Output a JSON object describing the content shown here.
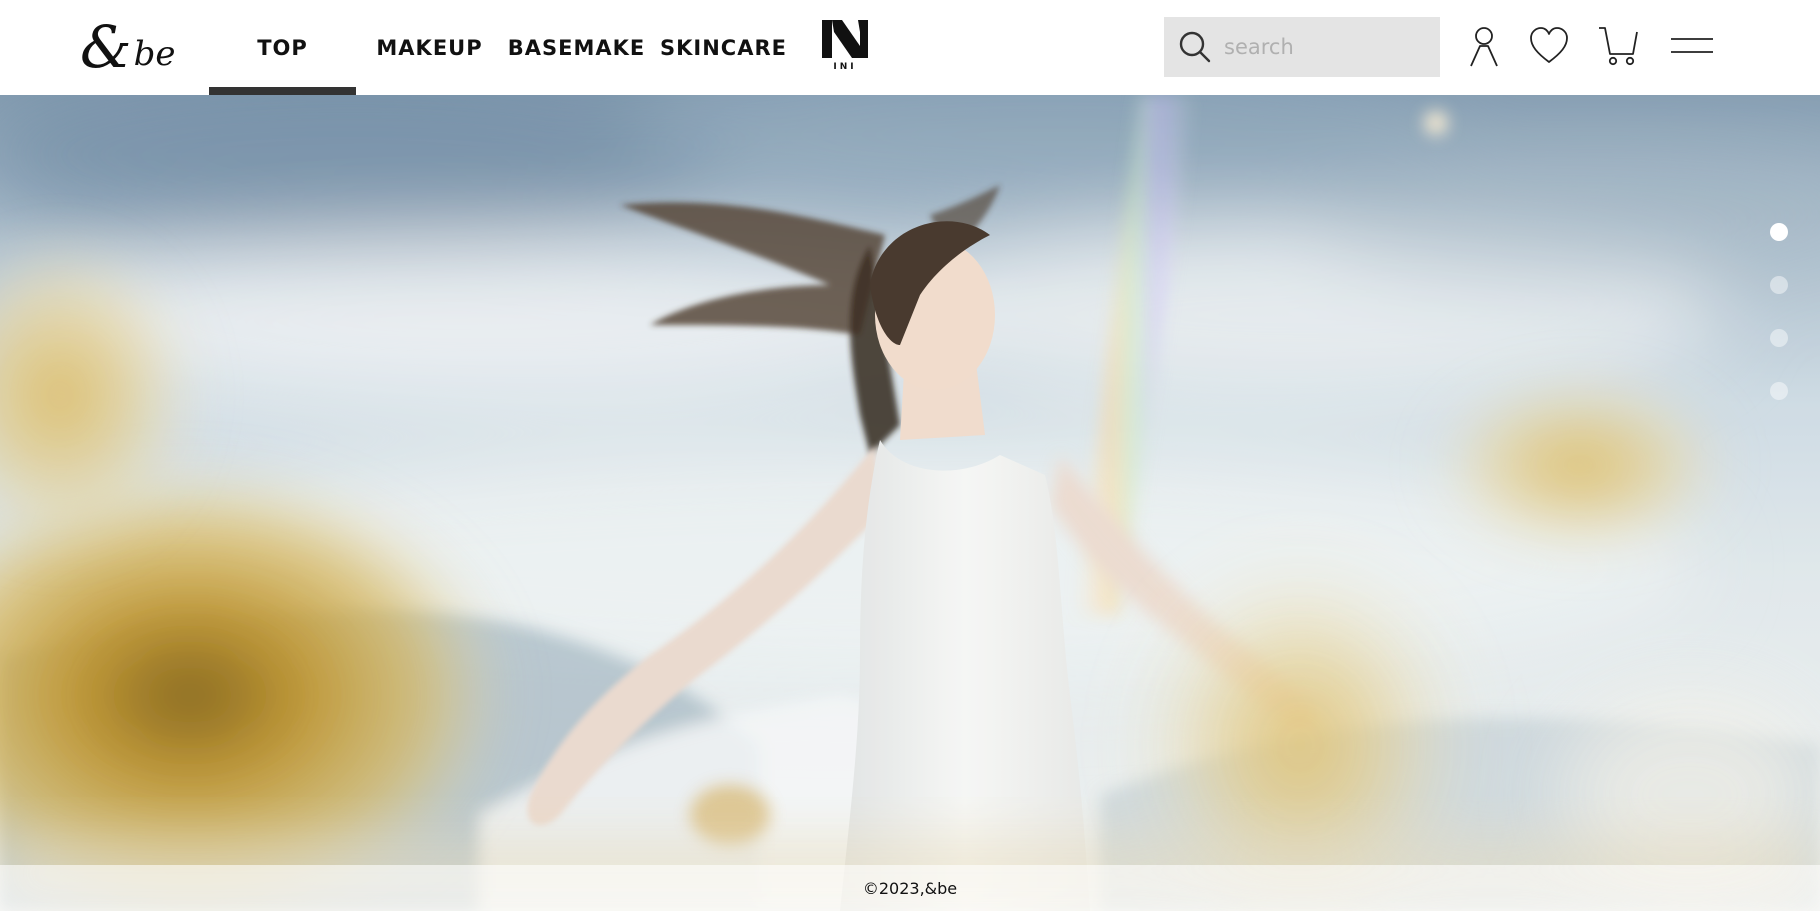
{
  "brand": {
    "logo_text": "&be",
    "logo_amp": "&",
    "logo_be": "be"
  },
  "nav": {
    "items": [
      {
        "label": "TOP",
        "active": true
      },
      {
        "label": "MAKEUP",
        "active": false
      },
      {
        "label": "BASEMAKE",
        "active": false
      },
      {
        "label": "SKINCARE",
        "active": false
      }
    ],
    "partner_logo": "INI"
  },
  "search": {
    "placeholder": "search",
    "value": ""
  },
  "header_icons": [
    "user-icon",
    "heart-icon",
    "cart-icon",
    "menu-icon"
  ],
  "hero": {
    "slide_count": 4,
    "active_slide": 1
  },
  "footer": {
    "copyright": "©2023,&be"
  },
  "colors": {
    "header_bg": "#ffffff",
    "search_bg": "#e4e4e4",
    "active_underline": "#333333",
    "text": "#111111",
    "sky": "#a9bccb",
    "flower": "#c9a23a"
  }
}
